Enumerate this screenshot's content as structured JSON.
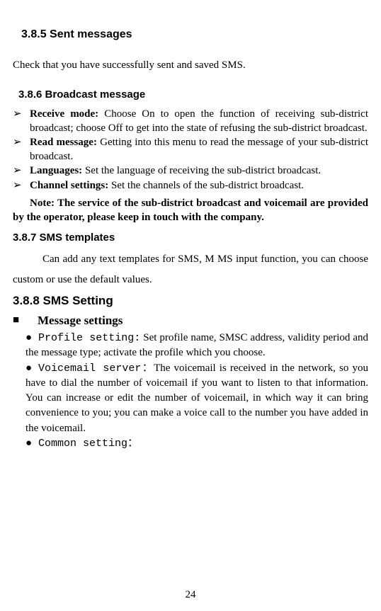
{
  "sections": {
    "s385": {
      "heading": "3.8.5 Sent messages",
      "body": "Check that you have successfully sent and saved SMS."
    },
    "s386": {
      "heading": "3.8.6 Broadcast message",
      "items": [
        {
          "label": "Receive mode:",
          "body": " Choose On to open the function of receiving sub-district broadcast; choose Off to get into the state of refusing the sub-district broadcast."
        },
        {
          "label": "Read message:",
          "body": " Getting into this menu to read the message of your sub-district broadcast."
        },
        {
          "label": "Languages:",
          "body": " Set the language of receiving the sub-district broadcast."
        },
        {
          "label": "Channel settings:",
          "body": " Set the channels of the sub-district broadcast."
        }
      ],
      "note": "Note: The service of the sub-district broadcast and voicemail are provided by the operator, please keep in touch with the company."
    },
    "s387": {
      "heading": "3.8.7 SMS templates",
      "body": "Can add any text templates for SMS, M MS input function, you can choose custom or use the default values."
    },
    "s388": {
      "heading": "3.8.8 SMS Setting",
      "sub_heading": "Message settings",
      "items": [
        {
          "mono": "Profile setting:",
          "body": " Set profile name, SMSC address, validity period and the message type; activate the profile which you choose."
        },
        {
          "mono": "Voicemail server：",
          "body": "The voicemail is received in the network, so you have to dial the number of voicemail if you want to listen to that information. You can increase or edit the number of voicemail, in which way it can bring convenience to you; you can make a voice call to the number you have added in the voicemail."
        },
        {
          "mono": "Common setting：",
          "body": ""
        }
      ]
    }
  },
  "page_number": "24"
}
